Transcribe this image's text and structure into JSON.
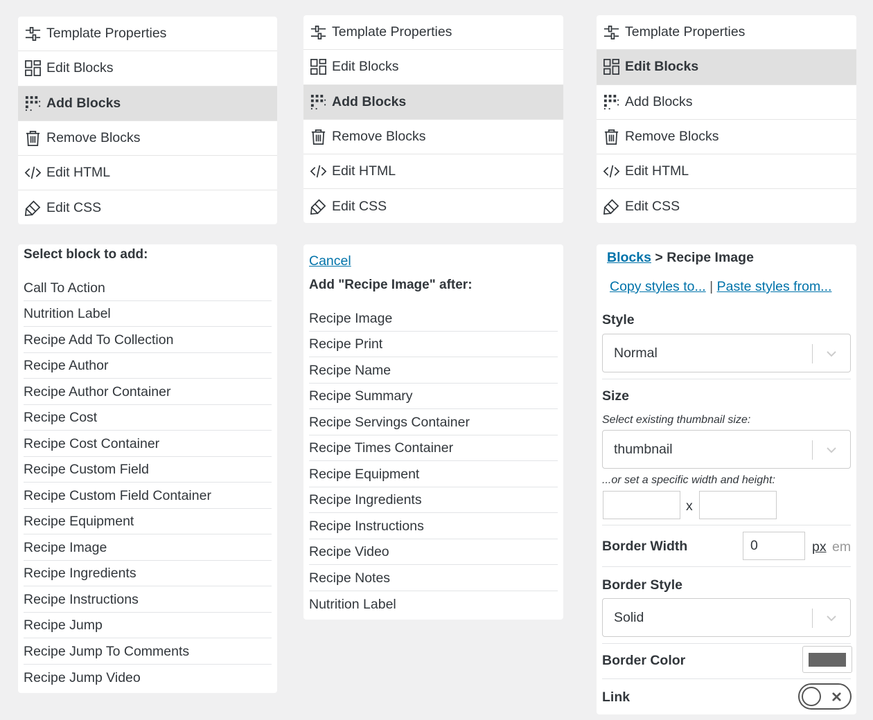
{
  "menu": {
    "items": [
      {
        "label": "Template Properties",
        "icon": "sliders-icon"
      },
      {
        "label": "Edit Blocks",
        "icon": "grid-icon"
      },
      {
        "label": "Add Blocks",
        "icon": "dots-grid-icon"
      },
      {
        "label": "Remove Blocks",
        "icon": "trash-icon"
      },
      {
        "label": "Edit HTML",
        "icon": "code-icon"
      },
      {
        "label": "Edit CSS",
        "icon": "brush-icon"
      }
    ],
    "active_panel_1": "Add Blocks",
    "active_panel_2": "Add Blocks",
    "active_panel_3": "Edit Blocks"
  },
  "panel1": {
    "heading": "Select block to add:",
    "items": [
      "Call To Action",
      "Nutrition Label",
      "Recipe Add To Collection",
      "Recipe Author",
      "Recipe Author Container",
      "Recipe Cost",
      "Recipe Cost Container",
      "Recipe Custom Field",
      "Recipe Custom Field Container",
      "Recipe Equipment",
      "Recipe Image",
      "Recipe Ingredients",
      "Recipe Instructions",
      "Recipe Jump",
      "Recipe Jump To Comments",
      "Recipe Jump Video"
    ]
  },
  "panel2": {
    "cancel": "Cancel",
    "heading": "Add \"Recipe Image\" after:",
    "items": [
      "Recipe Image",
      "Recipe Print",
      "Recipe Name",
      "Recipe Summary",
      "Recipe Servings Container",
      "Recipe Times Container",
      "Recipe Equipment",
      "Recipe Ingredients",
      "Recipe Instructions",
      "Recipe Video",
      "Recipe Notes",
      "Nutrition Label"
    ]
  },
  "panel3": {
    "breadcrumb_link": "Blocks",
    "breadcrumb_sep": ">",
    "breadcrumb_current": "Recipe Image",
    "copy_styles": "Copy styles to...",
    "pipe": "|",
    "paste_styles": "Paste styles from...",
    "style_label": "Style",
    "style_value": "Normal",
    "size_label": "Size",
    "size_hint": "Select existing thumbnail size:",
    "size_value": "thumbnail",
    "size_hint2": "...or set a specific width and height:",
    "x_label": "x",
    "border_width_label": "Border Width",
    "border_width_value": "0",
    "unit_px": "px",
    "unit_em": "em",
    "border_style_label": "Border Style",
    "border_style_value": "Solid",
    "border_color_label": "Border Color",
    "border_color": "#666666",
    "link_label": "Link",
    "link_on": false
  },
  "colors": {
    "accent": "#0073aa",
    "active_bg": "#e0e0e0",
    "page_bg": "#f0f0f1"
  }
}
